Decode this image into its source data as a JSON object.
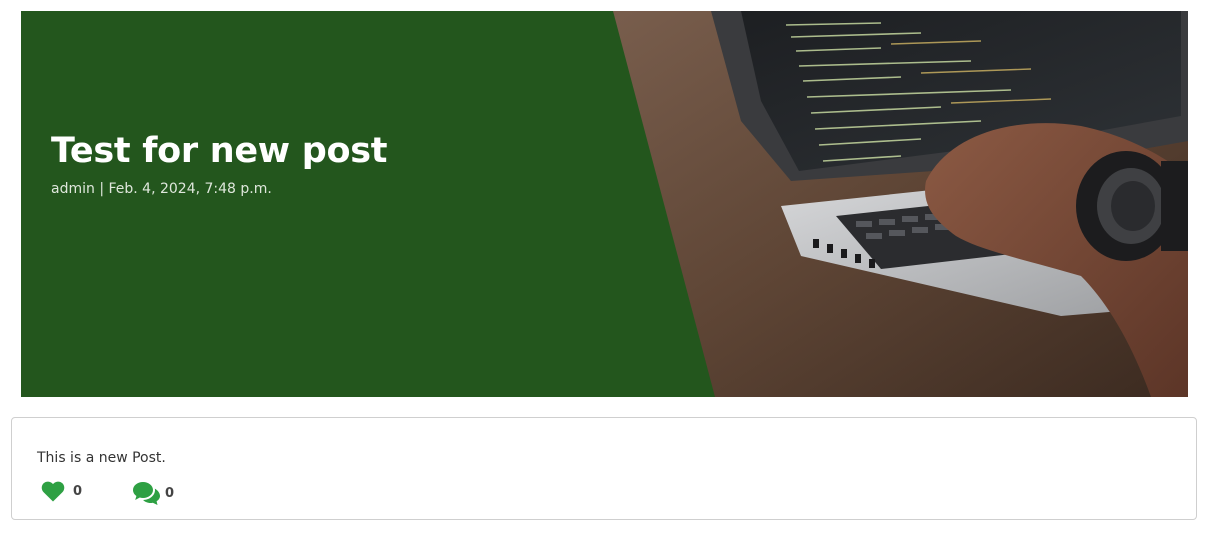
{
  "post": {
    "title": "Test for new post",
    "meta": "admin | Feb. 4, 2024, 7:48 p.m.",
    "body": "This is a new Post.",
    "likes": "0",
    "comments": "0"
  },
  "colors": {
    "hero_overlay": "#23561d",
    "icon_green": "#2ea043"
  },
  "icons": [
    "heart-icon",
    "comments-icon"
  ]
}
